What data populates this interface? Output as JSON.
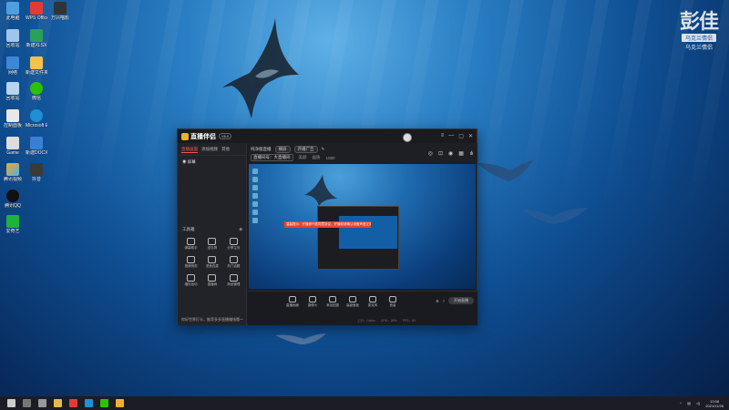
{
  "desktop": {
    "icons": [
      {
        "label": "此电脑"
      },
      {
        "label": "WPS Office"
      },
      {
        "label": "万兴喵影"
      },
      {
        "label": "回收站"
      },
      {
        "label": "新建XLSX"
      },
      {
        "label": "网络"
      },
      {
        "label": "新建文件夹"
      },
      {
        "label": "回收站"
      },
      {
        "label": "微信"
      },
      {
        "label": "控制面板"
      },
      {
        "label": "Microsoft Edge"
      },
      {
        "label": "Game"
      },
      {
        "label": "新建DOCX文档"
      },
      {
        "label": "腾讯视频"
      },
      {
        "label": "抖音"
      },
      {
        "label": "腾讯QQ"
      },
      {
        "label": "爱奇艺"
      }
    ]
  },
  "watermark": {
    "title": "彭佳",
    "badge": "乌克兰情侣",
    "sub": "乌克兰情侣"
  },
  "app": {
    "name": "直播伴侣",
    "version": "V8.0",
    "left_tabs": [
      "直播画面",
      "添加视频",
      "其他"
    ],
    "scene_item": "屏幕",
    "tools_title": "工具箱",
    "tools": [
      "弹幕助手",
      "送礼物",
      "分享主页",
      "视频快剪",
      "语音连麦",
      "热门话题",
      "福利活动",
      "直播间",
      "商品管理"
    ],
    "left_bottom": "你好世界打卡，推荐多多直播赚钱哦～",
    "top_row1": {
      "title": "纯净版直播",
      "btn1": "横屏",
      "btn2": "开播广告"
    },
    "top_row2": {
      "sel": "直播间号：大直播间",
      "a": "美颜",
      "b": "画质",
      "c": "1080"
    },
    "preview_toast": "温馨提示：开播即代表同意协议，开播前请确认设备声音正常开启",
    "bottom_buttons": [
      "直播画面",
      "摄像头",
      "添加贴图",
      "高级面板",
      "麦克风",
      "音量"
    ],
    "start_label": "开始直播",
    "status": [
      "上行：0 kb/s",
      "CPU：28%",
      "FPS：60"
    ]
  },
  "taskbar": {
    "time": "13:08",
    "date": "2021/11/26"
  }
}
